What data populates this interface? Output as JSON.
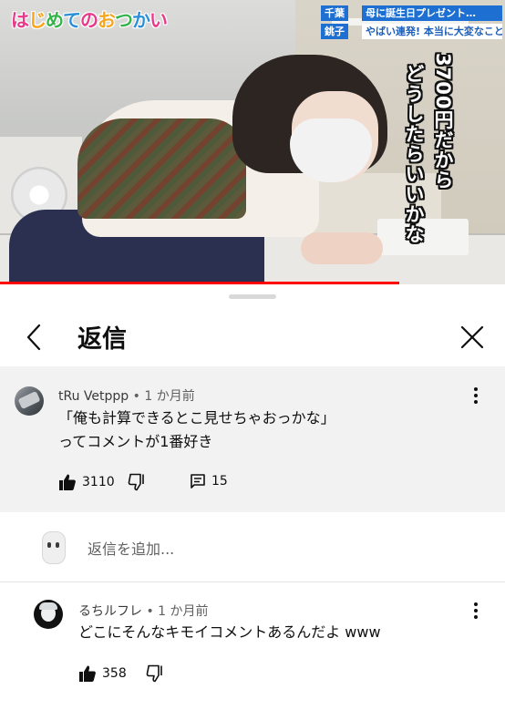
{
  "video": {
    "show_logo": "はじめてのおつかい",
    "logo_colors": [
      "#e8398a",
      "#f7a51c",
      "#35b44a",
      "#2a8fd8",
      "#e8398a",
      "#f7a51c",
      "#35b44a",
      "#2a8fd8",
      "#e8398a"
    ],
    "prefecture_tag": "千葉",
    "city_tag": "銚子",
    "title_tag": "母に誕生日プレゼント…",
    "subtitle_tag": "やばい連発! 本当に大変なことに…",
    "caption_line1": "3700円だから",
    "caption_line2": "どうしたらいいかな",
    "progress_fraction": 0.79,
    "progress_color": "#ff0000"
  },
  "sheet": {
    "title": "返信",
    "back_icon": "chevron-left-icon",
    "close_icon": "close-icon"
  },
  "parent_comment": {
    "author": "tRu Vetppp",
    "time": "1 か月前",
    "text": "「俺も計算できるとこ見せちゃおっかな」\nってコメントが1番好き",
    "likes": "3110",
    "replies": "15"
  },
  "add_reply": {
    "placeholder": "返信を追加..."
  },
  "reply": {
    "author": "るちルフレ",
    "time": "1 か月前",
    "text": "どこにそんなキモイコメントあるんだよ www",
    "likes": "358"
  },
  "separator": "•"
}
